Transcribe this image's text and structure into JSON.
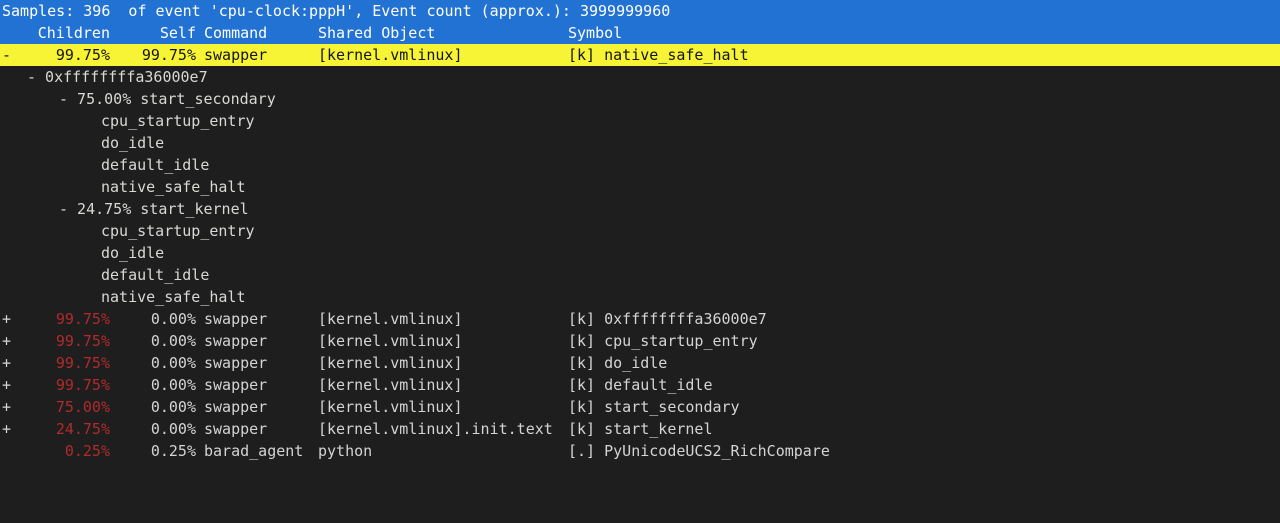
{
  "app": {
    "name": "perf report",
    "colors": {
      "background": "#1e1e1e",
      "header_bg": "#2272d4",
      "header_fg": "#ffffff",
      "selection_bg": "#f7f335",
      "selection_fg": "#151515",
      "percent_red": "#b02b2b",
      "text_fg": "#d4d4d4"
    }
  },
  "status_line": {
    "text": "Samples: 396  of event 'cpu-clock:pppH', Event count (approx.): 3999999960",
    "samples": "396",
    "event": "cpu-clock:pppH",
    "event_count": "3999999960"
  },
  "columns": {
    "marker": "",
    "children": "Children",
    "self": "Self",
    "command": "Command",
    "shared_object": "Shared Object",
    "symbol": "Symbol"
  },
  "selected_row": {
    "marker": "-",
    "children": "99.75%",
    "self": "99.75%",
    "command": "swapper",
    "shared_object": "[kernel.vmlinux]",
    "symbol": "[k] native_safe_halt"
  },
  "callgraph": [
    {
      "indent": "lvl1",
      "text": "- 0xffffffffa36000e7"
    },
    {
      "indent": "lvl2",
      "text": "- 75.00% start_secondary"
    },
    {
      "indent": "lvl3",
      "text": "cpu_startup_entry"
    },
    {
      "indent": "lvl3",
      "text": "do_idle"
    },
    {
      "indent": "lvl3",
      "text": "default_idle"
    },
    {
      "indent": "lvl3",
      "text": "native_safe_halt"
    },
    {
      "indent": "lvl2",
      "text": "- 24.75% start_kernel"
    },
    {
      "indent": "lvl3",
      "text": "cpu_startup_entry"
    },
    {
      "indent": "lvl3",
      "text": "do_idle"
    },
    {
      "indent": "lvl3",
      "text": "default_idle"
    },
    {
      "indent": "lvl3",
      "text": "native_safe_halt"
    }
  ],
  "rows": [
    {
      "marker": "+",
      "children": "99.75%",
      "self": "0.00%",
      "command": "swapper",
      "shared_object": "[kernel.vmlinux]",
      "symbol": "[k] 0xffffffffa36000e7"
    },
    {
      "marker": "+",
      "children": "99.75%",
      "self": "0.00%",
      "command": "swapper",
      "shared_object": "[kernel.vmlinux]",
      "symbol": "[k] cpu_startup_entry"
    },
    {
      "marker": "+",
      "children": "99.75%",
      "self": "0.00%",
      "command": "swapper",
      "shared_object": "[kernel.vmlinux]",
      "symbol": "[k] do_idle"
    },
    {
      "marker": "+",
      "children": "99.75%",
      "self": "0.00%",
      "command": "swapper",
      "shared_object": "[kernel.vmlinux]",
      "symbol": "[k] default_idle"
    },
    {
      "marker": "+",
      "children": "75.00%",
      "self": "0.00%",
      "command": "swapper",
      "shared_object": "[kernel.vmlinux]",
      "symbol": "[k] start_secondary"
    },
    {
      "marker": "+",
      "children": "24.75%",
      "self": "0.00%",
      "command": "swapper",
      "shared_object": "[kernel.vmlinux].init.text",
      "symbol": "[k] start_kernel"
    },
    {
      "marker": "",
      "children": "0.25%",
      "self": "0.25%",
      "command": "barad_agent",
      "shared_object": "python",
      "symbol": "[.] PyUnicodeUCS2_RichCompare"
    }
  ]
}
